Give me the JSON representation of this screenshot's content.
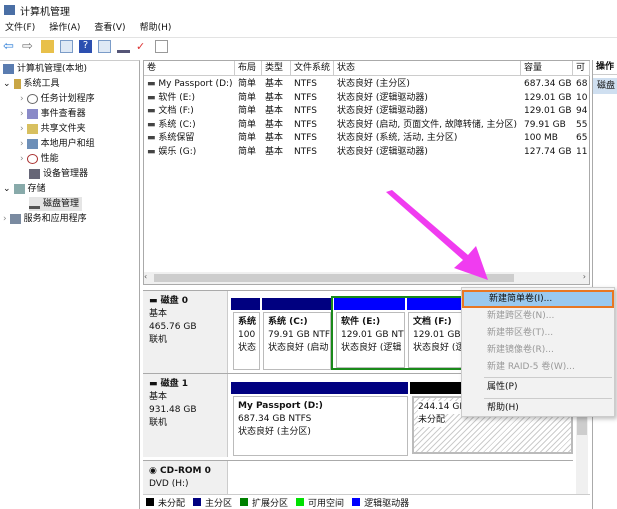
{
  "window": {
    "title": "计算机管理"
  },
  "menu": [
    "文件(F)",
    "操作(A)",
    "查看(V)",
    "帮助(H)"
  ],
  "tree": [
    {
      "label": "计算机管理(本地)",
      "icon": "computer-icon"
    },
    {
      "label": "系统工具",
      "icon": "tools-icon"
    },
    {
      "label": "任务计划程序",
      "icon": "clock-icon"
    },
    {
      "label": "事件查看器",
      "icon": "event-viewer-icon"
    },
    {
      "label": "共享文件夹",
      "icon": "shared-folder-icon"
    },
    {
      "label": "本地用户和组",
      "icon": "users-icon"
    },
    {
      "label": "性能",
      "icon": "performance-icon"
    },
    {
      "label": "设备管理器",
      "icon": "device-manager-icon"
    },
    {
      "label": "存储",
      "icon": "storage-icon"
    },
    {
      "label": "磁盘管理",
      "icon": "disk-icon"
    },
    {
      "label": "服务和应用程序",
      "icon": "services-icon"
    }
  ],
  "table": {
    "headers": [
      "卷",
      "布局",
      "类型",
      "文件系统",
      "状态",
      "容量",
      "可"
    ],
    "rows": [
      [
        "My Passport (D:)",
        "简单",
        "基本",
        "NTFS",
        "状态良好 (主分区)",
        "687.34 GB",
        "68"
      ],
      [
        "软件 (E:)",
        "简单",
        "基本",
        "NTFS",
        "状态良好 (逻辑驱动器)",
        "129.01 GB",
        "10"
      ],
      [
        "文档 (F:)",
        "简单",
        "基本",
        "NTFS",
        "状态良好 (逻辑驱动器)",
        "129.01 GB",
        "94"
      ],
      [
        "系统 (C:)",
        "简单",
        "基本",
        "NTFS",
        "状态良好 (启动, 页面文件, 故障转储, 主分区)",
        "79.91 GB",
        "55"
      ],
      [
        "系统保留",
        "简单",
        "基本",
        "NTFS",
        "状态良好 (系统, 活动, 主分区)",
        "100 MB",
        "65"
      ],
      [
        "娱乐 (G:)",
        "简单",
        "基本",
        "NTFS",
        "状态良好 (逻辑驱动器)",
        "127.74 GB",
        "11"
      ]
    ]
  },
  "actions": {
    "header": "操作",
    "item": "磁盘"
  },
  "disks": [
    {
      "name": "磁盘 0",
      "type": "基本",
      "size": "465.76 GB",
      "status": "联机",
      "parts": [
        {
          "l1": "系统",
          "l2": "100",
          "l3": "状态"
        },
        {
          "l1": "系统  (C:)",
          "l2": "79.91 GB NTF",
          "l3": "状态良好 (启动"
        },
        {
          "l1": "软件  (E:)",
          "l2": "129.01 GB NT",
          "l3": "状态良好 (逻辑"
        },
        {
          "l1": "文档  (F:)",
          "l2": "129.01 GB N",
          "l3": "状态良好 (逻"
        }
      ]
    },
    {
      "name": "磁盘 1",
      "type": "基本",
      "size": "931.48 GB",
      "status": "联机",
      "parts": [
        {
          "l1": "My Passport  (D:)",
          "l2": "687.34 GB NTFS",
          "l3": "状态良好 (主分区)"
        },
        {
          "l1": "",
          "l2": "244.14 GB",
          "l3": "未分配"
        }
      ]
    },
    {
      "name": "CD-ROM 0",
      "type": "DVD (H:)"
    }
  ],
  "context_menu": [
    {
      "label": "新建简单卷(I)...",
      "enabled": true,
      "highlighted": true
    },
    {
      "label": "新建跨区卷(N)...",
      "enabled": false
    },
    {
      "label": "新建带区卷(T)...",
      "enabled": false
    },
    {
      "label": "新建镜像卷(R)...",
      "enabled": false
    },
    {
      "label": "新建 RAID-5 卷(W)...",
      "enabled": false
    },
    {
      "label": "属性(P)",
      "enabled": true
    },
    {
      "label": "帮助(H)",
      "enabled": true
    }
  ],
  "legend": [
    {
      "label": "未分配",
      "color": "#000000"
    },
    {
      "label": "主分区",
      "color": "#000080"
    },
    {
      "label": "扩展分区",
      "color": "#008000"
    },
    {
      "label": "可用空间",
      "color": "#00e000"
    },
    {
      "label": "逻辑驱动器",
      "color": "#0000ff"
    }
  ],
  "colors": {
    "highlight": "#99c9ef",
    "highlight_border": "#e87722",
    "arrow": "#f03cf0"
  }
}
